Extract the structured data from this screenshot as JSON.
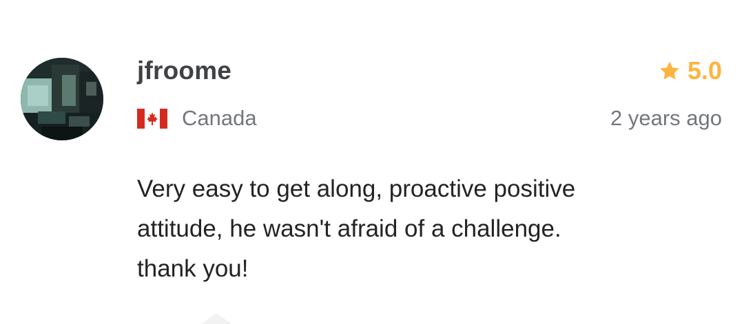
{
  "review": {
    "username": "jfroome",
    "rating": "5.0",
    "country": "Canada",
    "country_flag_icon": "canada-flag-icon",
    "timestamp": "2 years ago",
    "body_lines": [
      "Very easy to get along, proactive positive",
      "attitude, he wasn't afraid of a challenge.",
      "thank you!"
    ]
  },
  "colors": {
    "star": "#ffb33e",
    "username": "#404145",
    "muted": "#74767e",
    "body": "#222325",
    "flag_red": "#d52b1e"
  },
  "icons": {
    "rating": "star-icon",
    "avatar": "avatar"
  }
}
